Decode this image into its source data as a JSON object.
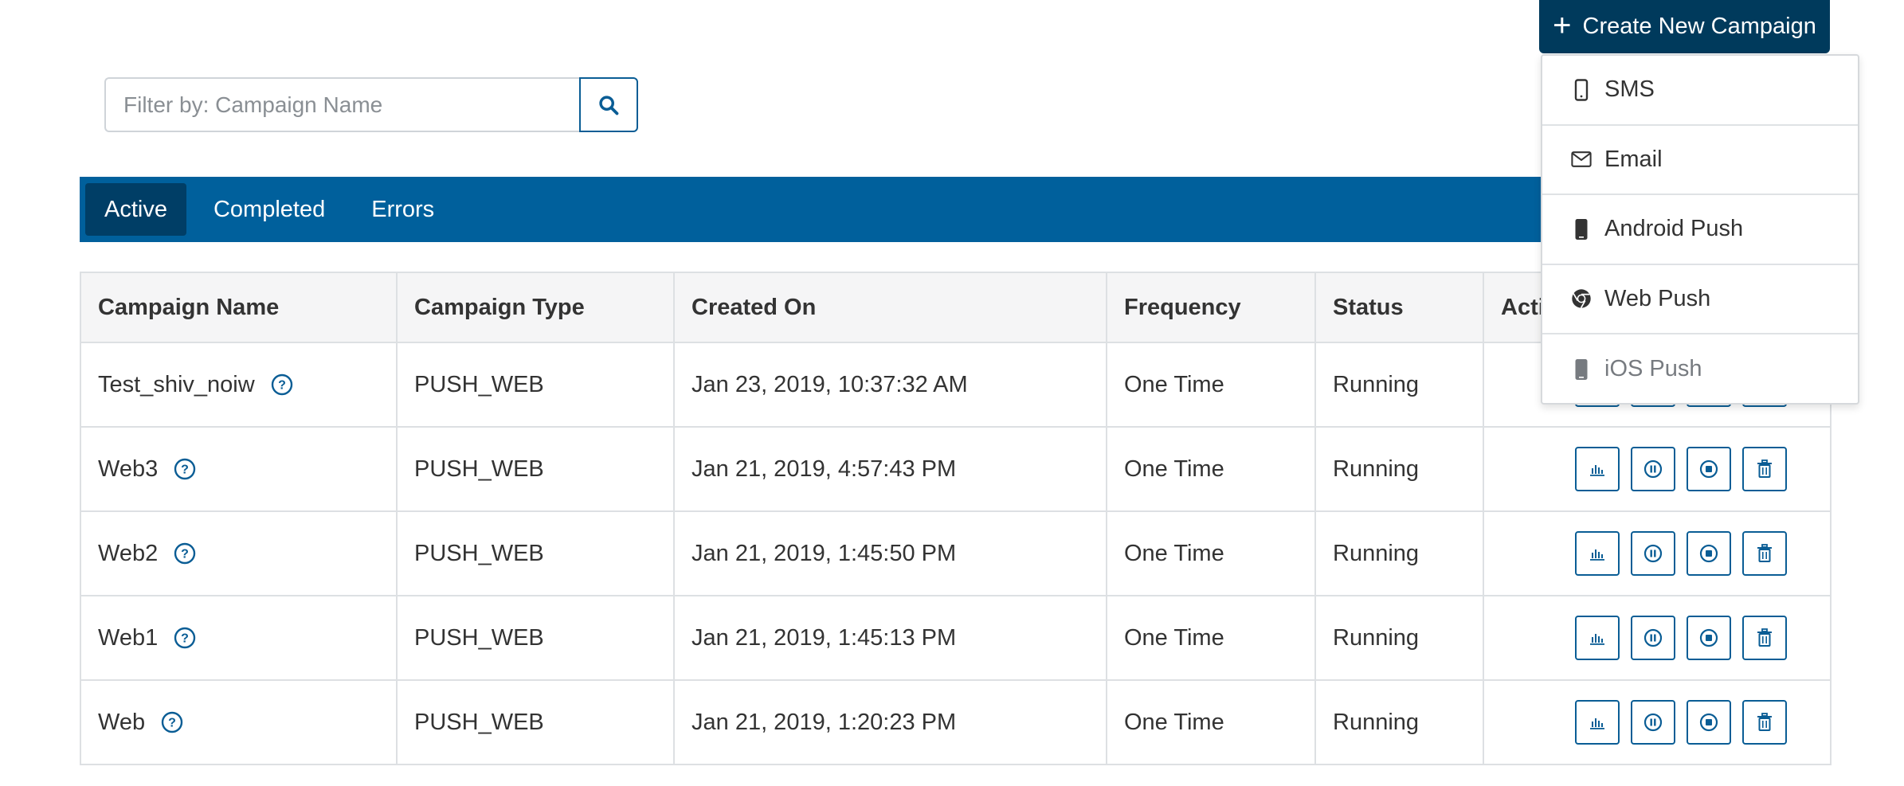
{
  "header": {
    "create_button_label": "Create New Campaign"
  },
  "filter": {
    "placeholder": "Filter by: Campaign Name"
  },
  "tabs": [
    {
      "label": "Active",
      "active": true
    },
    {
      "label": "Completed",
      "active": false
    },
    {
      "label": "Errors",
      "active": false
    }
  ],
  "table": {
    "columns": [
      "Campaign Name",
      "Campaign Type",
      "Created On",
      "Frequency",
      "Status",
      "Actions"
    ],
    "rows": [
      {
        "name": "Test_shiv_noiw",
        "type": "PUSH_WEB",
        "created": "Jan 23, 2019, 10:37:32 AM",
        "frequency": "One Time",
        "status": "Running"
      },
      {
        "name": "Web3",
        "type": "PUSH_WEB",
        "created": "Jan 21, 2019, 4:57:43 PM",
        "frequency": "One Time",
        "status": "Running"
      },
      {
        "name": "Web2",
        "type": "PUSH_WEB",
        "created": "Jan 21, 2019, 1:45:50 PM",
        "frequency": "One Time",
        "status": "Running"
      },
      {
        "name": "Web1",
        "type": "PUSH_WEB",
        "created": "Jan 21, 2019, 1:45:13 PM",
        "frequency": "One Time",
        "status": "Running"
      },
      {
        "name": "Web",
        "type": "PUSH_WEB",
        "created": "Jan 21, 2019, 1:20:23 PM",
        "frequency": "One Time",
        "status": "Running"
      }
    ],
    "row_actions": [
      "chart-icon",
      "pause-icon",
      "stop-icon",
      "trash-icon"
    ]
  },
  "dropdown": {
    "items": [
      {
        "label": "SMS",
        "icon": "mobile-icon"
      },
      {
        "label": "Email",
        "icon": "envelope-icon"
      },
      {
        "label": "Android Push",
        "icon": "android-phone-icon"
      },
      {
        "label": "Web Push",
        "icon": "chrome-icon"
      },
      {
        "label": "iOS Push",
        "icon": "ios-phone-icon"
      }
    ]
  },
  "colors": {
    "primary_dark": "#003a5c",
    "tab_bar": "#00609c",
    "accent": "#0a5d95"
  }
}
